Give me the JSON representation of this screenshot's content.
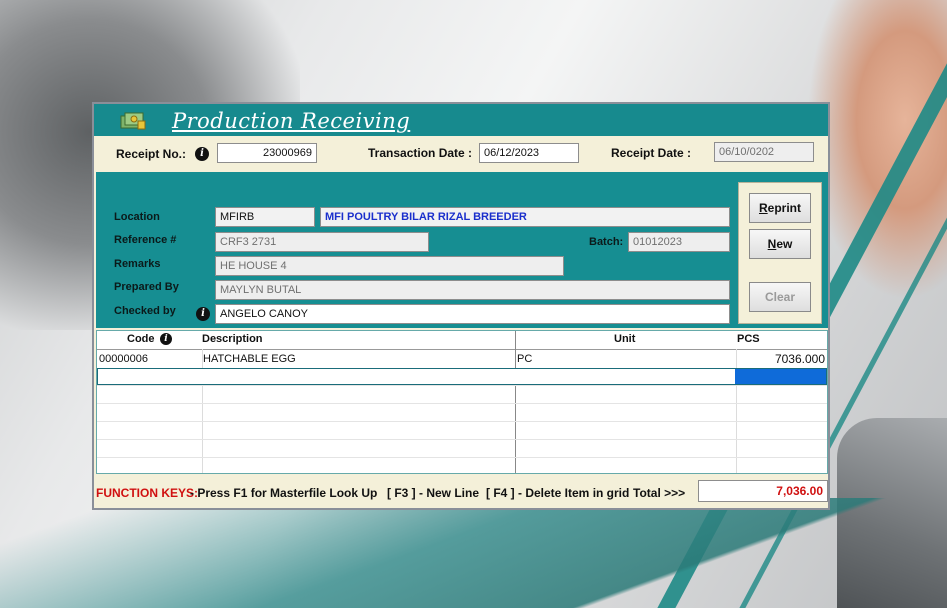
{
  "window": {
    "title": "Production Receiving"
  },
  "header": {
    "receipt_no_label": "Receipt No.:",
    "receipt_no": "23000969",
    "transaction_date_label": "Transaction Date :",
    "transaction_date": "06/12/2023",
    "receipt_date_label": "Receipt Date :",
    "receipt_date": "06/10/0202"
  },
  "details": {
    "location_label": "Location",
    "location_code": "MFIRB",
    "location_name": "MFI POULTRY BILAR RIZAL BREEDER",
    "reference_label": "Reference #",
    "reference": "CRF3 2731",
    "batch_label": "Batch:",
    "batch": "01012023",
    "remarks_label": "Remarks",
    "remarks": "HE HOUSE 4",
    "prepared_by_label": "Prepared By",
    "prepared_by": "MAYLYN BUTAL",
    "checked_by_label": "Checked by",
    "checked_by": "ANGELO CANOY"
  },
  "buttons": {
    "reprint": "Reprint",
    "new": "New",
    "clear": "Clear"
  },
  "grid": {
    "columns": [
      "Code",
      "Description",
      "Unit",
      "PCS"
    ],
    "rows": [
      {
        "code": "00000006",
        "description": "HATCHABLE EGG",
        "unit": "PC",
        "pcs": "7036.000"
      }
    ]
  },
  "footer": {
    "function_keys_label": "FUNCTION KEYS:",
    "f1_text": "- Press F1 for Masterfile Look Up",
    "f3_text": "[ F3 ] - New Line",
    "f4_text": "[ F4 ] - Delete Item in grid",
    "total_label": "Total >>>",
    "total_value": "7,036.00"
  },
  "colors": {
    "teal": "#168e92",
    "cream": "#f4f0d9",
    "total_red": "#d01010",
    "location_blue": "#1a2fcc",
    "selection_blue": "#0f6bd9"
  }
}
